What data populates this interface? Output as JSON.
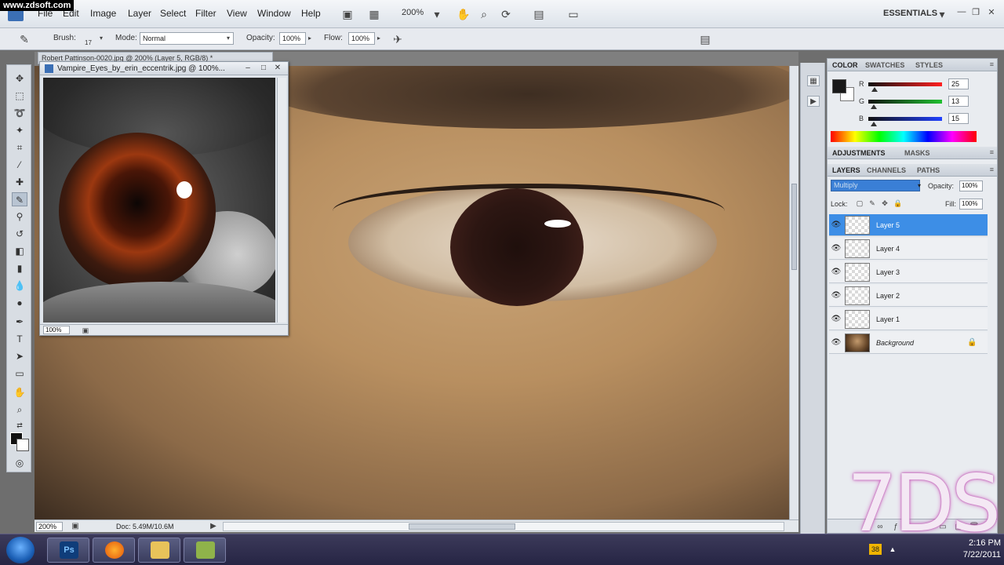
{
  "watermark": "www.zdsoft.com",
  "menus": [
    "File",
    "Edit",
    "Image",
    "Layer",
    "Select",
    "Filter",
    "View",
    "Window",
    "Help"
  ],
  "menubar": {
    "zoom": "200%",
    "workspace": "ESSENTIALS"
  },
  "options": {
    "brush_label": "Brush:",
    "brush_size": "17",
    "mode_label": "Mode:",
    "mode_value": "Normal",
    "opacity_label": "Opacity:",
    "opacity_value": "100%",
    "flow_label": "Flow:",
    "flow_value": "100%"
  },
  "main_doc": {
    "tab": "Robert Pattinson-0020.jpg @ 200% (Layer 5, RGB/8) *",
    "zoom": "200%",
    "doc_size": "Doc: 5.49M/10.6M"
  },
  "float_doc": {
    "title": "Vampire_Eyes_by_erin_eccentrik.jpg @ 100%...",
    "zoom": "100%"
  },
  "color_panel": {
    "tabs": [
      "COLOR",
      "SWATCHES",
      "STYLES"
    ],
    "channels": [
      {
        "label": "R",
        "value": "25",
        "color": "#d42020"
      },
      {
        "label": "G",
        "value": "13",
        "color": "#20a030"
      },
      {
        "label": "B",
        "value": "15",
        "color": "#2040c8"
      }
    ]
  },
  "adjust_tabs": [
    "ADJUSTMENTS",
    "MASKS"
  ],
  "layers_panel": {
    "tabs": [
      "LAYERS",
      "CHANNELS",
      "PATHS"
    ],
    "blend_mode": "Multiply",
    "opacity_label": "Opacity:",
    "opacity_value": "100%",
    "lock_label": "Lock:",
    "fill_label": "Fill:",
    "fill_value": "100%",
    "layers": [
      {
        "name": "Layer 5",
        "selected": true
      },
      {
        "name": "Layer 4",
        "selected": false
      },
      {
        "name": "Layer 3",
        "selected": false
      },
      {
        "name": "Layer 2",
        "selected": false
      },
      {
        "name": "Layer 1",
        "selected": false
      },
      {
        "name": "Background",
        "selected": false,
        "locked": true
      }
    ]
  },
  "brand": "7DS",
  "taskbar": {
    "apps": [
      "Ps",
      "Firefox",
      "Explorer",
      "App"
    ],
    "clock_time": "2:16 PM",
    "clock_date": "7/22/2011"
  }
}
